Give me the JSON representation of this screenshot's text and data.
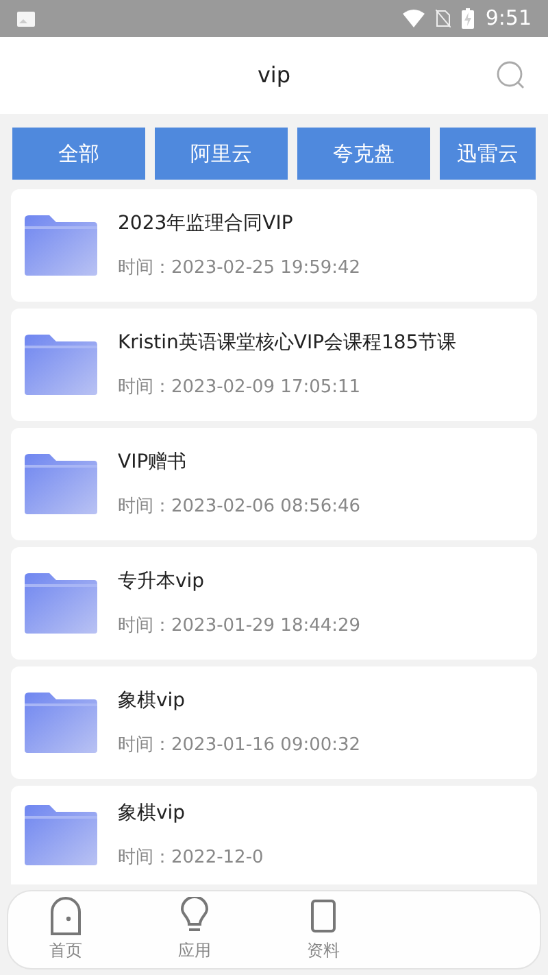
{
  "status_bar": {
    "time": "9:51"
  },
  "header": {
    "title": "vip"
  },
  "tabs": [
    {
      "label": "全部"
    },
    {
      "label": "阿里云"
    },
    {
      "label": "夸克盘"
    },
    {
      "label": "迅雷云"
    }
  ],
  "folders": [
    {
      "name": "2023年监理合同VIP",
      "time": "时间：2023-02-25 19:59:42"
    },
    {
      "name": "Kristin英语课堂核心VIP会课程185节课",
      "time": "时间：2023-02-09 17:05:11"
    },
    {
      "name": "VIP赠书",
      "time": "时间：2023-02-06 08:56:46"
    },
    {
      "name": "专升本vip",
      "time": "时间：2023-01-29 18:44:29"
    },
    {
      "name": "象棋vip",
      "time": "时间：2023-01-16 09:00:32"
    },
    {
      "name": "象棋vip",
      "time": "时间：2022-12-0"
    }
  ],
  "bottom_nav": [
    {
      "label": "首页",
      "kind": "home"
    },
    {
      "label": "应用",
      "kind": "bulb"
    },
    {
      "label": "资料",
      "kind": "doc"
    }
  ]
}
